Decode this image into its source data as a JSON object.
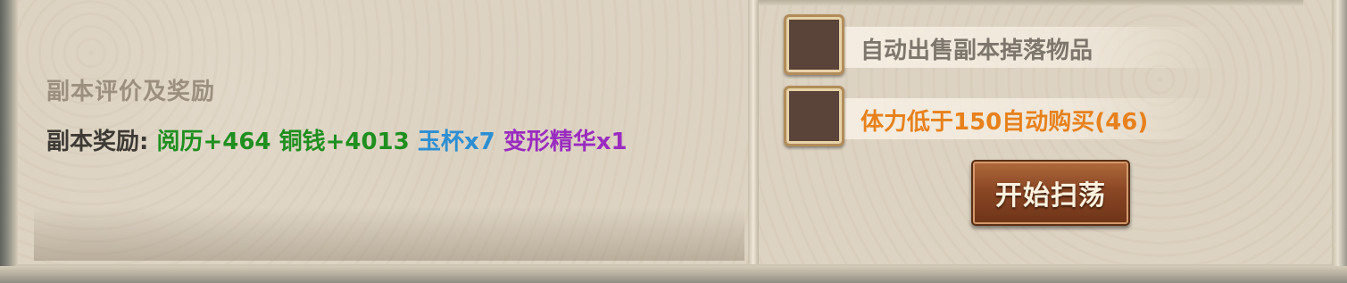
{
  "reward_section": {
    "title": "副本评价及奖励",
    "reward_label": "副本奖励:",
    "rewards": [
      {
        "text": "阅历+464",
        "color": "#1f8f1f"
      },
      {
        "text": "铜钱+4013",
        "color": "#1f8f1f"
      },
      {
        "text": "玉杯x7",
        "color": "#2d8fd2"
      },
      {
        "text": "变形精华x1",
        "color": "#9a2cc0"
      }
    ]
  },
  "options": {
    "auto_sell": {
      "label": "自动出售副本掉落物品",
      "checked": false
    },
    "auto_buy": {
      "label": "体力低于150自动购买(46)",
      "checked": false
    }
  },
  "actions": {
    "start_sweep_label": "开始扫荡"
  },
  "colors": {
    "panel": "#ddd3c2",
    "button": "#8a4725",
    "checkbox_fill": "#5a4339",
    "highlight_orange": "#e7811c"
  }
}
